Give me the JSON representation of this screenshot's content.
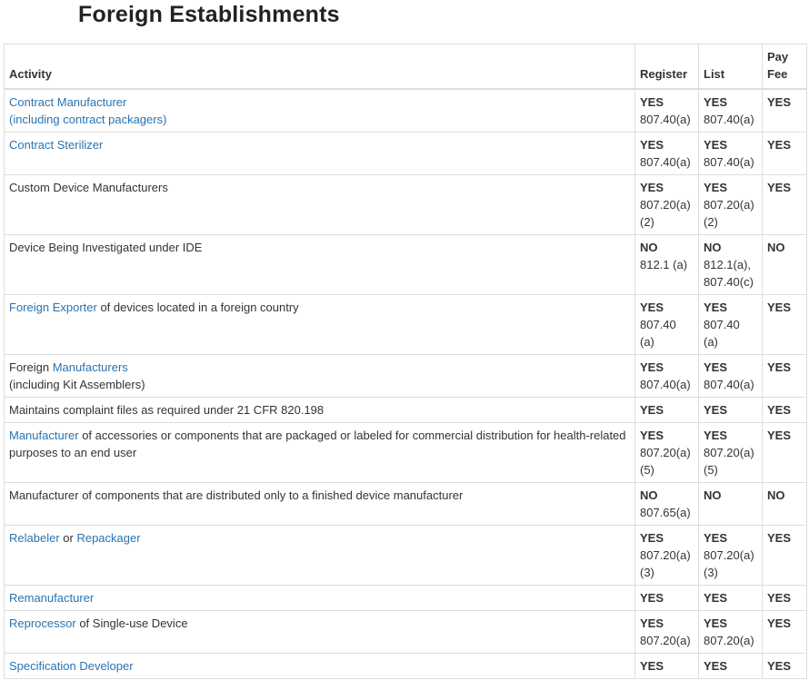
{
  "title": "Foreign Establishments",
  "headers": {
    "activity": "Activity",
    "register": "Register",
    "list": "List",
    "fee_line1": "Pay",
    "fee_line2": "Fee"
  },
  "rows": [
    {
      "act": [
        {
          "t": "Contract Manufacturer",
          "link": true
        }
      ],
      "act2": [
        {
          "t": "(including contract packagers)",
          "link": true
        }
      ],
      "reg": "YES",
      "reg_ref": "807.40(a)",
      "list": "YES",
      "list_ref": "807.40(a)",
      "fee": "YES"
    },
    {
      "act": [
        {
          "t": "Contract Sterilizer",
          "link": true
        }
      ],
      "reg": "YES",
      "reg_ref": "807.40(a)",
      "list": "YES",
      "list_ref": "807.40(a)",
      "fee": "YES"
    },
    {
      "act": [
        {
          "t": "Custom Device Manufacturers",
          "link": false
        }
      ],
      "reg": "YES",
      "reg_ref": "807.20(a)",
      "reg_ref2": "(2)",
      "list": "YES",
      "list_ref": "807.20(a)",
      "list_ref2": "(2)",
      "fee": "YES"
    },
    {
      "act": [
        {
          "t": "Device Being Investigated under IDE",
          "link": false
        }
      ],
      "reg": "NO",
      "reg_ref": "812.1 (a)",
      "list": "NO",
      "list_ref": "812.1(a),",
      "list_ref2": "807.40(c)",
      "fee": "NO"
    },
    {
      "act": [
        {
          "t": "Foreign Exporter",
          "link": true
        },
        {
          "t": " of devices located in a foreign country",
          "link": false
        }
      ],
      "reg": "YES",
      "reg_ref": "807.40 (a)",
      "list": "YES",
      "list_ref": "807.40 (a)",
      "fee": "YES"
    },
    {
      "act": [
        {
          "t": "Foreign ",
          "link": false
        },
        {
          "t": "Manufacturers",
          "link": true
        }
      ],
      "act2": [
        {
          "t": "(including Kit Assemblers)",
          "link": false
        }
      ],
      "reg": "YES",
      "reg_ref": "807.40(a)",
      "list": "YES",
      "list_ref": "807.40(a)",
      "fee": "YES"
    },
    {
      "act": [
        {
          "t": "Maintains complaint files as required under 21 CFR 820.198",
          "link": false
        }
      ],
      "reg": "YES",
      "list": "YES",
      "fee": "YES"
    },
    {
      "act": [
        {
          "t": "Manufacturer",
          "link": true
        },
        {
          "t": " of accessories or components that are packaged or labeled for commercial distribution for health-related purposes to an end user",
          "link": false
        }
      ],
      "reg": "YES",
      "reg_ref": "807.20(a)",
      "reg_ref2": "(5)",
      "list": "YES",
      "list_ref": "807.20(a)",
      "list_ref2": "(5)",
      "fee": "YES"
    },
    {
      "act": [
        {
          "t": "Manufacturer of components that are distributed only to a finished device manufacturer",
          "link": false
        }
      ],
      "reg": "NO",
      "reg_ref": "807.65(a)",
      "list": "NO",
      "fee": "NO"
    },
    {
      "act": [
        {
          "t": "Relabeler",
          "link": true
        },
        {
          "t": " or ",
          "link": false
        },
        {
          "t": "Repackager",
          "link": true
        }
      ],
      "reg": "YES",
      "reg_ref": "807.20(a)",
      "reg_ref2": "(3)",
      "list": "YES",
      "list_ref": "807.20(a)",
      "list_ref2": "(3)",
      "fee": "YES"
    },
    {
      "act": [
        {
          "t": "Remanufacturer",
          "link": true
        }
      ],
      "reg": "YES",
      "list": "YES",
      "fee": "YES"
    },
    {
      "act": [
        {
          "t": "Reprocessor",
          "link": true
        },
        {
          "t": " of Single-use Device",
          "link": false
        }
      ],
      "reg": "YES",
      "reg_ref": "807.20(a)",
      "list": "YES",
      "list_ref": "807.20(a)",
      "fee": "YES"
    },
    {
      "act": [
        {
          "t": "Specification Developer",
          "link": true
        }
      ],
      "reg": "YES",
      "list": "YES",
      "fee": "YES"
    }
  ],
  "colors": {
    "link": "#2a73b0",
    "text": "#333333",
    "border": "#dddddd"
  }
}
